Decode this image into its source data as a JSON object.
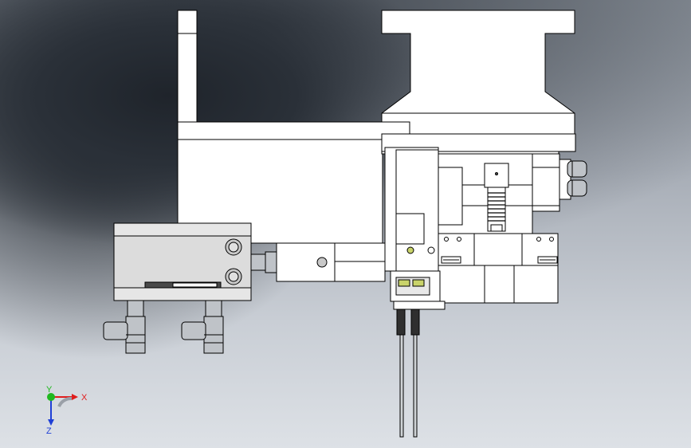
{
  "viewport": {
    "background_colors": [
      "#1f242b",
      "#8e959e",
      "#dde1e6"
    ],
    "part_colors": {
      "face": "#ffffff",
      "edge": "#000000",
      "cylinder_body": "#dcdcdc",
      "fitting_metal": "#bfc3c8",
      "sensor_strip": "#4a4a4a",
      "tube": "#cfd3d6"
    }
  },
  "triad": {
    "x_label": "X",
    "y_label": "Y",
    "z_label": "Z",
    "x_color": "#e01c1c",
    "y_color": "#1fb81f",
    "z_color": "#1f3fd6"
  }
}
